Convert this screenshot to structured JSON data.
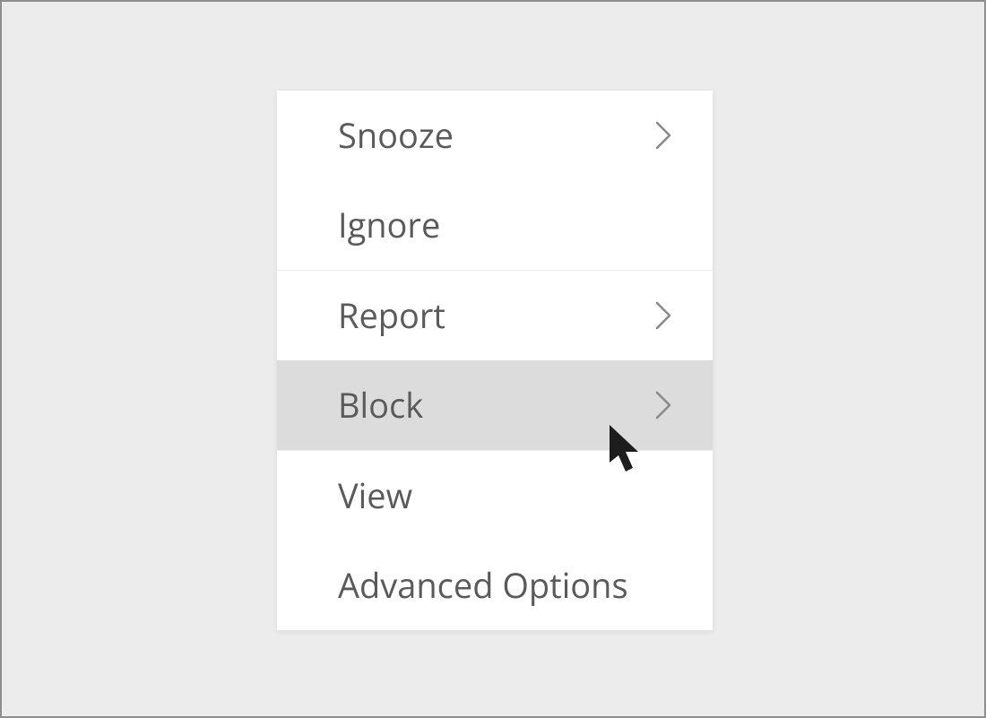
{
  "menu": {
    "items": [
      {
        "label": "Snooze",
        "has_submenu": true,
        "hovered": false
      },
      {
        "label": "Ignore",
        "has_submenu": false,
        "hovered": false
      },
      {
        "label": "Report",
        "has_submenu": true,
        "hovered": false,
        "separator_before": true
      },
      {
        "label": "Block",
        "has_submenu": true,
        "hovered": true,
        "separator_after": true
      },
      {
        "label": "View",
        "has_submenu": false,
        "hovered": false
      },
      {
        "label": "Advanced Options",
        "has_submenu": false,
        "hovered": false
      }
    ]
  }
}
